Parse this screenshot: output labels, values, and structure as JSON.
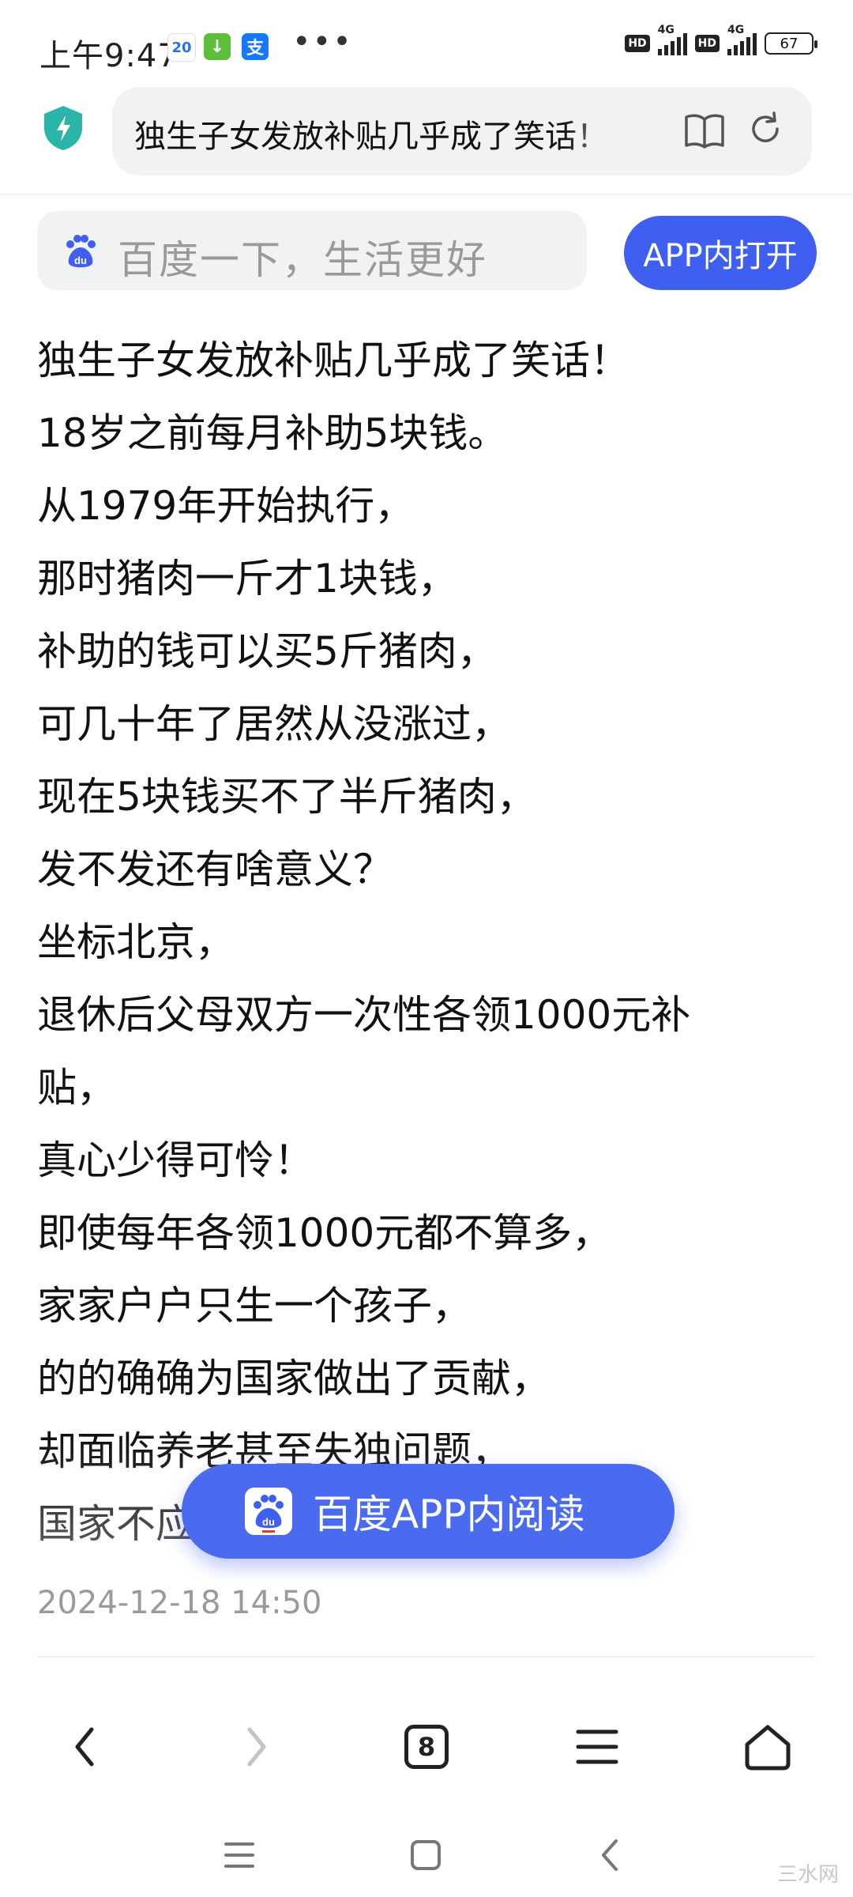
{
  "status_bar": {
    "time": "上午9:47",
    "calendar_badge": "20",
    "pay_badge": "支",
    "more": "•••",
    "hd1": "HD",
    "net1": "4G",
    "hd2": "HD",
    "net2": "4G",
    "battery": "67"
  },
  "address_bar": {
    "page_title": "独生子女发放补贴几乎成了笑话！"
  },
  "search": {
    "placeholder": "百度一下，生活更好",
    "open_in_app": "APP内打开"
  },
  "article": {
    "lines": [
      "独生子女发放补贴几乎成了笑话！",
      "18岁之前每月补助5块钱。",
      "从1979年开始执行，",
      "那时猪肉一斤才1块钱，",
      "补助的钱可以买5斤猪肉，",
      "可几十年了居然从没涨过，",
      "现在5块钱买不了半斤猪肉，",
      "发不发还有啥意义？",
      "坐标北京，",
      "退休后父母双方一次性各领1000元补",
      "贴，",
      "真心少得可怜！",
      "即使每年各领1000元都不算多，",
      "家家户户只生一个孩子，",
      "的的确确为国家做出了贡献，",
      "却面临养老甚至失独问题，",
      "国家不应"
    ],
    "date": "2024-12-18 14:50"
  },
  "float_button": {
    "label": "百度APP内阅读"
  },
  "toolbar": {
    "tab_count": "8"
  },
  "watermark": "三水网",
  "colors": {
    "accent": "#3e5ff0",
    "float": "#4a6bf0",
    "shield": "#2bb5a8"
  }
}
